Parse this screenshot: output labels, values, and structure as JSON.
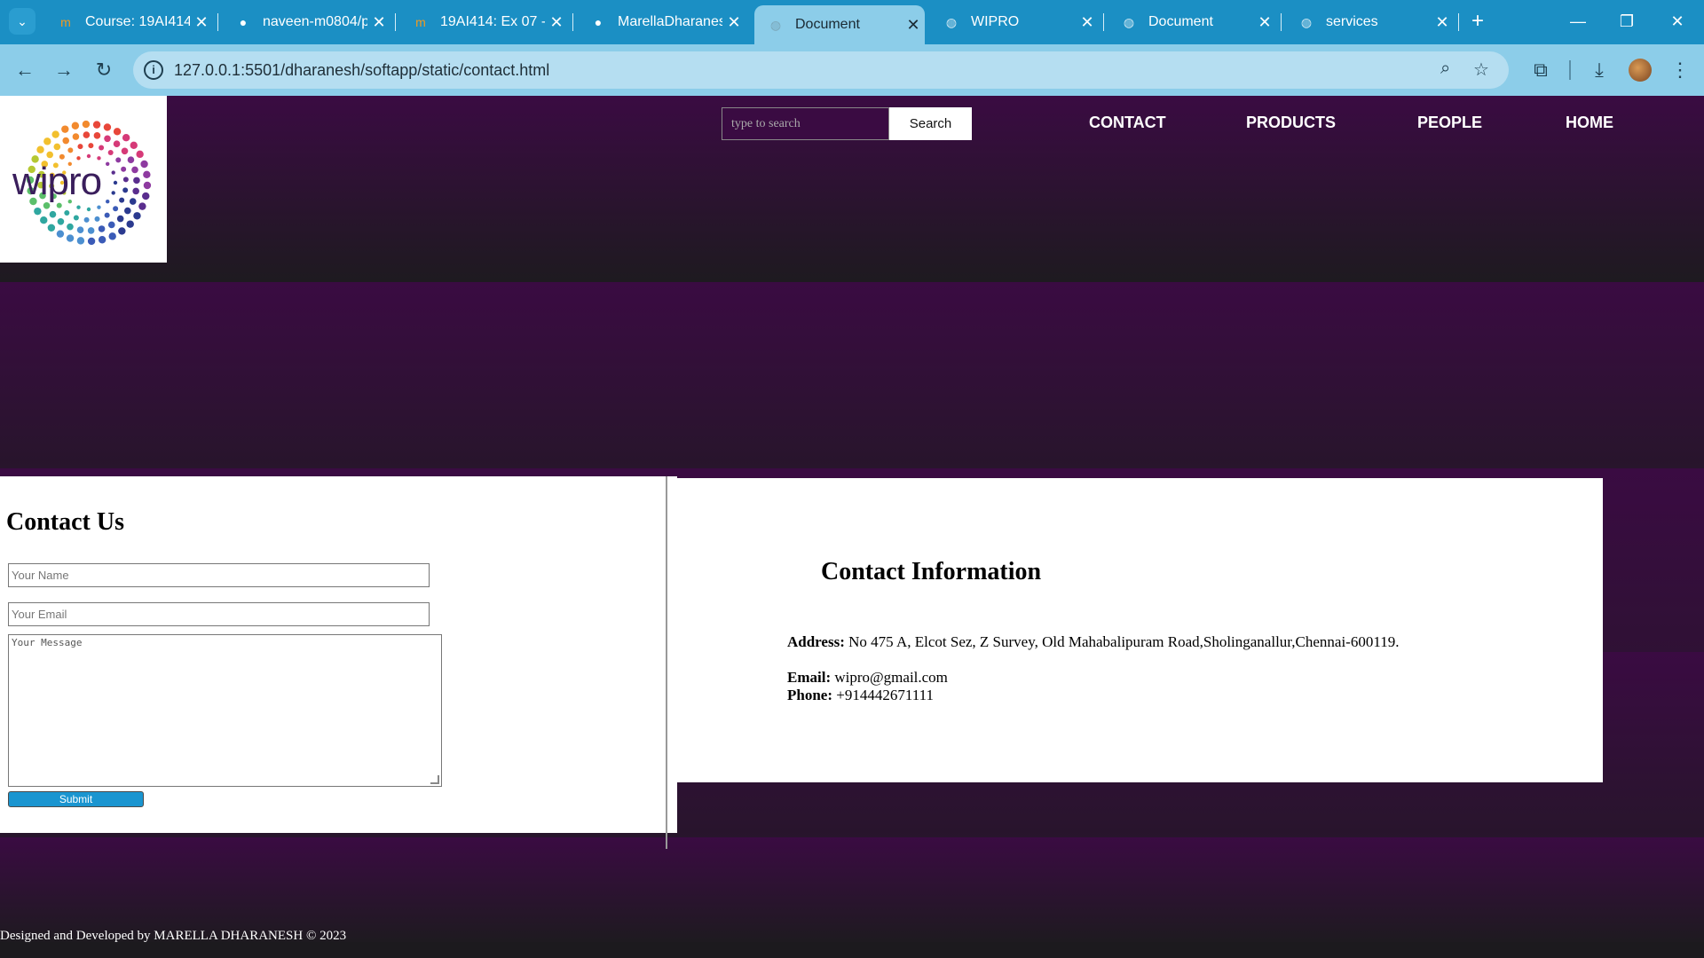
{
  "browser": {
    "tabs": [
      {
        "title": "Course: 19AI414",
        "favicon": "moodle-icon",
        "active": false
      },
      {
        "title": "naveen-m0804/p",
        "favicon": "github-icon",
        "active": false
      },
      {
        "title": "19AI414: Ex 07 -",
        "favicon": "moodle-icon",
        "active": false
      },
      {
        "title": "MarellaDharanes",
        "favicon": "github-icon",
        "active": false
      },
      {
        "title": "Document",
        "favicon": "globe-icon",
        "active": true
      },
      {
        "title": "WIPRO",
        "favicon": "globe-icon",
        "active": false
      },
      {
        "title": "Document",
        "favicon": "globe-icon",
        "active": false
      },
      {
        "title": "services",
        "favicon": "globe-icon",
        "active": false
      }
    ],
    "url": "127.0.0.1:5501/dharanesh/softapp/static/contact.html"
  },
  "header": {
    "logo_text": "wipro",
    "search": {
      "placeholder": "type to search",
      "button_label": "Search"
    },
    "nav": [
      "CONTACT",
      "PRODUCTS",
      "PEOPLE",
      "HOME"
    ]
  },
  "contact_form": {
    "heading": "Contact Us",
    "name_placeholder": "Your Name",
    "email_placeholder": "Your Email",
    "message_placeholder": "Your Message",
    "submit_label": "Submit"
  },
  "contact_info": {
    "heading": "Contact Information",
    "address_label": "Address:",
    "address": "No 475 A, Elcot Sez, Z Survey, Old Mahabalipuram Road,Sholinganallur,Chennai-600119.",
    "email_label": "Email:",
    "email": "wipro@gmail.com",
    "phone_label": "Phone:",
    "phone": "+914442671111"
  },
  "footer": {
    "text": "Designed and Developed by MARELLA DHARANESH © 2023"
  },
  "colors": {
    "band_top": "#3a0b42",
    "band_bottom": "#1e1a20",
    "tabbar": "#1b8fc4",
    "toolbar": "#8ccde9",
    "submit": "#1a95d0"
  }
}
